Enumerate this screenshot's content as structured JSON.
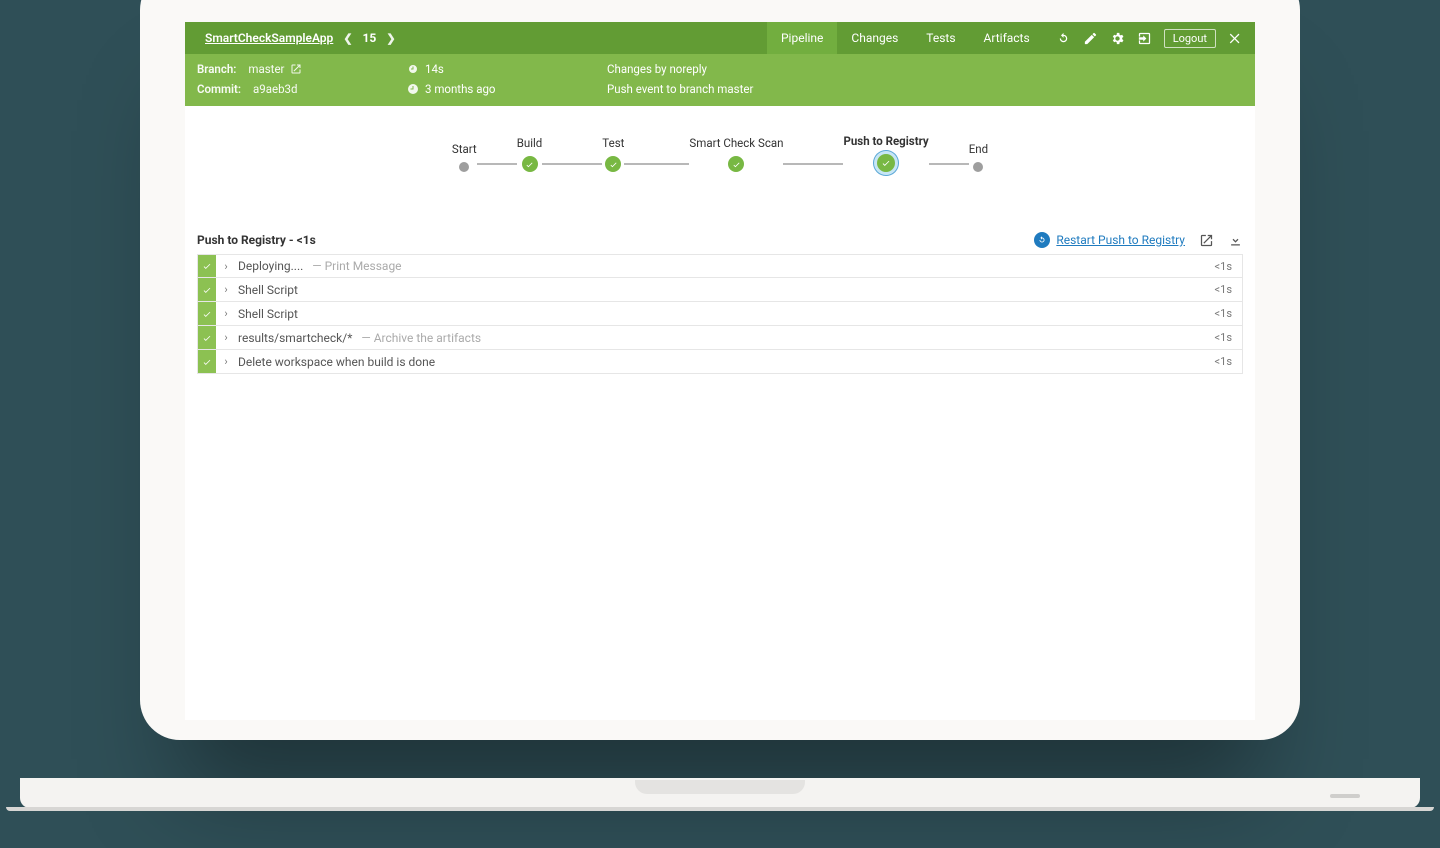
{
  "header": {
    "project_name": "SmartCheckSampleApp",
    "build_number": "15",
    "tabs": [
      {
        "label": "Pipeline",
        "active": true
      },
      {
        "label": "Changes",
        "active": false
      },
      {
        "label": "Tests",
        "active": false
      },
      {
        "label": "Artifacts",
        "active": false
      }
    ],
    "logout_label": "Logout"
  },
  "subheader": {
    "branch_label": "Branch:",
    "branch_value": "master",
    "commit_label": "Commit:",
    "commit_value": "a9aeb3d",
    "duration": "14s",
    "age": "3 months ago",
    "changes_by": "Changes by noreply",
    "event": "Push event to branch master"
  },
  "pipeline": {
    "stages": [
      {
        "name": "Start",
        "kind": "term"
      },
      {
        "name": "Build",
        "kind": "ok"
      },
      {
        "name": "Test",
        "kind": "ok"
      },
      {
        "name": "Smart Check Scan",
        "kind": "ok"
      },
      {
        "name": "Push to Registry",
        "kind": "sel"
      },
      {
        "name": "End",
        "kind": "term"
      }
    ],
    "selected_index": 4
  },
  "stage_detail": {
    "title": "Push to Registry",
    "duration": "<1s",
    "restart_label": "Restart Push to Registry",
    "steps": [
      {
        "primary": "Deploying....",
        "secondary": "— Print Message",
        "duration": "<1s"
      },
      {
        "primary": "Shell Script",
        "secondary": "",
        "duration": "<1s"
      },
      {
        "primary": "Shell Script",
        "secondary": "",
        "duration": "<1s"
      },
      {
        "primary": "results/smartcheck/*",
        "secondary": "— Archive the artifacts",
        "duration": "<1s"
      },
      {
        "primary": "Delete workspace when build is done",
        "secondary": "",
        "duration": "<1s"
      }
    ]
  }
}
